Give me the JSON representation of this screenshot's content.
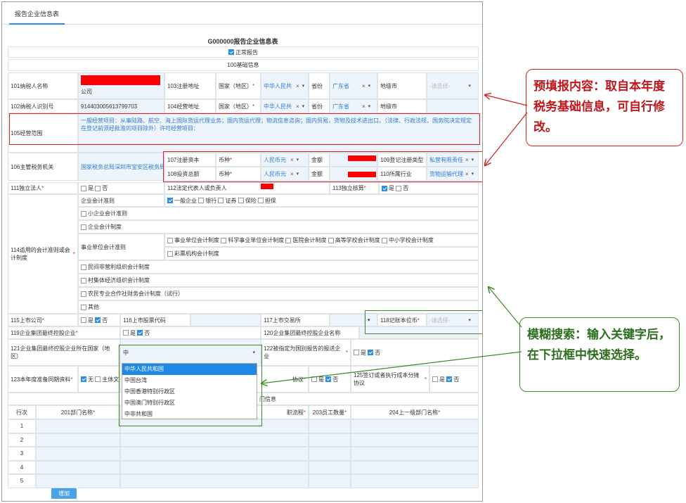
{
  "tab": {
    "label": "报告企业信息表"
  },
  "form_title": "G000000报告企业信息表",
  "normal_report": {
    "label": "正常报告",
    "checked": true
  },
  "section_100": "100基础信息",
  "r101": {
    "label": "101纳税人名称",
    "value_suffix": "公司"
  },
  "r103": {
    "label": "103注册地址",
    "country_label": "国家（地区）",
    "country": "中华人民共",
    "province_label": "省份",
    "province": "广东省",
    "city_label": "地级市",
    "city_placeholder": "-请选择-"
  },
  "r102": {
    "label": "102纳税人识别号",
    "value": "914403005613799703"
  },
  "r104": {
    "label": "104经营地址",
    "country_label": "国家（地区）",
    "country": "中华人民共",
    "province_label": "省份",
    "province": "广东省",
    "city_label": "地级市"
  },
  "r105": {
    "label": "105经营范围",
    "value": "一般经营项目：从事陆路、航空、海上国际货运代理业务；国内货运代理；物流信息咨询；国内贸易，货物及技术进出口。（法律、行政法规、国务院决定规定在登记前须经批准的项目除外）许可经营项目："
  },
  "r106": {
    "label": "106主管税务机关",
    "value": "国家税务总局深圳市宝安区税务局"
  },
  "r107": {
    "label": "107注册资本",
    "currency_label": "币种",
    "currency": "人民币元",
    "amount_label": "金额"
  },
  "r108": {
    "label": "108投资总额",
    "currency_label": "币种",
    "currency": "人民币元",
    "amount_label": "金额"
  },
  "r109": {
    "label": "109登记注册类型",
    "value": "私营有限责任"
  },
  "r110": {
    "label": "110所属行业",
    "value": "货物运输代理"
  },
  "r111": {
    "label": "111独立法人",
    "yes": "是",
    "no": "否"
  },
  "r112": {
    "label": "112法定代表人或负责人"
  },
  "r113": {
    "label": "113独立核算",
    "yes": "是",
    "no": "否"
  },
  "r114": {
    "label": "114适用的会计准则或会计制度",
    "enterprise_std": "企业会计准则",
    "enterprise_opts": [
      "一般企业",
      "银行",
      "证券",
      "保险",
      "担保"
    ],
    "small_std": "小企业会计准则",
    "ent_system": "企业会计制度",
    "institution_label": "事业单位会计准则",
    "institution_opts": [
      "事业单位会计制度",
      "科学事业单位会计制度",
      "医院会计制度",
      "高等学校会计制度",
      "中小学校会计制度"
    ],
    "lottery": "彩票机构会计制度",
    "nonprofit": "民间非营利组织会计制度",
    "village": "村集体经济组织会计制度",
    "farmer": "农民专业合作社财务会计制度（试行）",
    "other": "其他"
  },
  "r115": {
    "label": "115上市公司",
    "yes": "是",
    "no": "否"
  },
  "r116": {
    "label": "116上市股票代码"
  },
  "r117": {
    "label": "117上市交易所"
  },
  "r118": {
    "label": "118记账本位币",
    "placeholder": "-请选择-"
  },
  "r119": {
    "label": "119企业集团最终控股企业",
    "yes": "是",
    "no": "否"
  },
  "r120": {
    "label": "120企业集团最终控股企业名称"
  },
  "r121": {
    "label": "121企业集团最终控股企业所在国家（地区）",
    "input": "中"
  },
  "r122": {
    "label": "122被指定为国别报告的报送企业",
    "yes": "是",
    "no": "否"
  },
  "r123": {
    "label": "123本年度准备同期资料",
    "opt1": "无",
    "opt2": "主体文"
  },
  "r124": {
    "label": "协议",
    "yes": "是",
    "no": "否"
  },
  "r125": {
    "label": "125是否与企业集团签订了成本分摊协议",
    "label_short": "125签订或者执行成本分摊协议",
    "yes": "是",
    "no": "否"
  },
  "dept_section": "门信息",
  "table": {
    "headers": [
      "行次",
      "201部门名称",
      "203员工数量",
      "204上一级部门名称"
    ],
    "h202": "职流程",
    "rows": [
      "1",
      "2",
      "3",
      "4",
      "5"
    ]
  },
  "add_button": "增加",
  "dropdown": {
    "items": [
      "中华人民共和国",
      "中国台湾",
      "中国香港特别行政区",
      "中国澳门特别行政区",
      "中非共和国"
    ],
    "active": 0
  },
  "callout_red": "预填报内容：取自本年度税务基础信息，可自行修改。",
  "callout_green": "模糊搜索：输入关键字后，在下拉框中快速选择。",
  "colors": {
    "accent": "#2b8de6",
    "red_annotation": "#d42020",
    "green_annotation": "#3d8a2a"
  }
}
